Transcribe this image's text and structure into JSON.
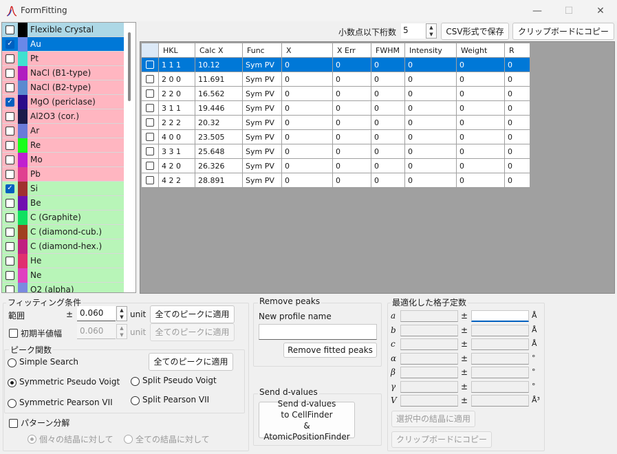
{
  "window": {
    "title": "FormFitting",
    "minimize": "—",
    "maximize": "☐",
    "close": "✕"
  },
  "crystals": [
    {
      "name": "Flexible Crystal",
      "checked": false,
      "swatch": "#000000",
      "bg": "#add8e6",
      "text": "#1a1a1a"
    },
    {
      "name": "Au",
      "checked": true,
      "swatch": "#6a88e8",
      "bg": "#0078d7",
      "text": "#ffffff"
    },
    {
      "name": "Pt",
      "checked": false,
      "swatch": "#40e0d0",
      "bg": "#ffb6c1",
      "text": "#1a1a1a"
    },
    {
      "name": "NaCl (B1-type)",
      "checked": false,
      "swatch": "#b11cc0",
      "bg": "#ffb6c1",
      "text": "#1a1a1a"
    },
    {
      "name": "NaCl (B2-type)",
      "checked": false,
      "swatch": "#5a8ad0",
      "bg": "#ffb6c1",
      "text": "#1a1a1a"
    },
    {
      "name": "MgO (periclase)",
      "checked": true,
      "swatch": "#2a0a8a",
      "bg": "#ffb6c1",
      "text": "#1a1a1a"
    },
    {
      "name": "Al2O3 (cor.)",
      "checked": false,
      "swatch": "#1a1a4a",
      "bg": "#ffb6c1",
      "text": "#1a1a1a"
    },
    {
      "name": "Ar",
      "checked": false,
      "swatch": "#6a7ad8",
      "bg": "#ffb6c1",
      "text": "#1a1a1a"
    },
    {
      "name": "Re",
      "checked": false,
      "swatch": "#1aff1a",
      "bg": "#ffb6c1",
      "text": "#1a1a1a"
    },
    {
      "name": "Mo",
      "checked": false,
      "swatch": "#c020d0",
      "bg": "#ffb6c1",
      "text": "#1a1a1a"
    },
    {
      "name": "Pb",
      "checked": false,
      "swatch": "#e04090",
      "bg": "#ffb6c1",
      "text": "#1a1a1a"
    },
    {
      "name": "Si",
      "checked": true,
      "swatch": "#a03030",
      "bg": "#b8f5b8",
      "text": "#1a1a1a"
    },
    {
      "name": "Be",
      "checked": false,
      "swatch": "#7010b0",
      "bg": "#b8f5b8",
      "text": "#1a1a1a"
    },
    {
      "name": "C (Graphite)",
      "checked": false,
      "swatch": "#10e060",
      "bg": "#b8f5b8",
      "text": "#1a1a1a"
    },
    {
      "name": "C (diamond-cub.)",
      "checked": false,
      "swatch": "#a04020",
      "bg": "#b8f5b8",
      "text": "#1a1a1a"
    },
    {
      "name": "C (diamond-hex.)",
      "checked": false,
      "swatch": "#c02080",
      "bg": "#b8f5b8",
      "text": "#1a1a1a"
    },
    {
      "name": "He",
      "checked": false,
      "swatch": "#e03070",
      "bg": "#b8f5b8",
      "text": "#1a1a1a"
    },
    {
      "name": "Ne",
      "checked": false,
      "swatch": "#e040c0",
      "bg": "#b8f5b8",
      "text": "#1a1a1a"
    },
    {
      "name": "O2 (alpha)",
      "checked": false,
      "swatch": "#7a8ae0",
      "bg": "#b8f5b8",
      "text": "#1a1a1a"
    }
  ],
  "toolbar": {
    "decimals_label": "小数点以下桁数",
    "decimals_value": "5",
    "csv_button": "CSV形式で保存",
    "clipboard_button": "クリップボードにコピー"
  },
  "grid": {
    "columns": [
      "HKL",
      "Calc X",
      "Func",
      "X",
      "X Err",
      "FWHM",
      "Intensity",
      "Weight",
      "R"
    ],
    "rows": [
      [
        "1 1 1",
        "10.12",
        "Sym PV",
        "0",
        "0",
        "0",
        "0",
        "0",
        "0"
      ],
      [
        "2 0 0",
        "11.691",
        "Sym PV",
        "0",
        "0",
        "0",
        "0",
        "0",
        "0"
      ],
      [
        "2 2 0",
        "16.562",
        "Sym PV",
        "0",
        "0",
        "0",
        "0",
        "0",
        "0"
      ],
      [
        "3 1 1",
        "19.446",
        "Sym PV",
        "0",
        "0",
        "0",
        "0",
        "0",
        "0"
      ],
      [
        "2 2 2",
        "20.32",
        "Sym PV",
        "0",
        "0",
        "0",
        "0",
        "0",
        "0"
      ],
      [
        "4 0 0",
        "23.505",
        "Sym PV",
        "0",
        "0",
        "0",
        "0",
        "0",
        "0"
      ],
      [
        "3 3 1",
        "25.648",
        "Sym PV",
        "0",
        "0",
        "0",
        "0",
        "0",
        "0"
      ],
      [
        "4 2 0",
        "26.326",
        "Sym PV",
        "0",
        "0",
        "0",
        "0",
        "0",
        "0"
      ],
      [
        "4 2 2",
        "28.891",
        "Sym PV",
        "0",
        "0",
        "0",
        "0",
        "0",
        "0"
      ]
    ],
    "selected_row": 0
  },
  "fitting": {
    "group_label": "フィッティング条件",
    "range_label": "範囲",
    "pm": "±",
    "range_value": "0.060",
    "unit": "unit",
    "apply_all": "全てのピークに適用",
    "init_fwhm_label": "初期半値幅",
    "init_fwhm_value": "0.060",
    "profile_group_label": "ピーク関数",
    "simple_search": "Simple Search",
    "sym_pseudo_voigt": "Symmetric Pseudo Voigt",
    "split_pseudo_voigt": "Split Pseudo Voigt",
    "sym_pearson": "Symmetric Pearson VII",
    "split_pearson": "Split Pearson VII",
    "pattern_decomp": "パターン分解",
    "each_crystal": "個々の結晶に対して",
    "all_crystals": "全ての結晶に対して"
  },
  "remove_peaks": {
    "group_label": "Remove peaks",
    "new_profile_label": "New profile name",
    "remove_button": "Remove fitted peaks"
  },
  "send_d": {
    "group_label": "Send d-values",
    "button_line1": "Send d-values",
    "button_line2": "to CellFinder",
    "button_line3": "& AtomicPositionFinder"
  },
  "lattice": {
    "group_label": "最適化した格子定数",
    "params": [
      {
        "symbol": "a",
        "unit": "Å"
      },
      {
        "symbol": "b",
        "unit": "Å"
      },
      {
        "symbol": "c",
        "unit": "Å"
      },
      {
        "symbol": "α",
        "unit": "°"
      },
      {
        "symbol": "β",
        "unit": "°"
      },
      {
        "symbol": "γ",
        "unit": "°"
      },
      {
        "symbol": "V",
        "unit": "Å³"
      }
    ],
    "pm": "±",
    "apply_button": "選択中の結晶に適用",
    "copy_button": "クリップボードにコピー"
  }
}
